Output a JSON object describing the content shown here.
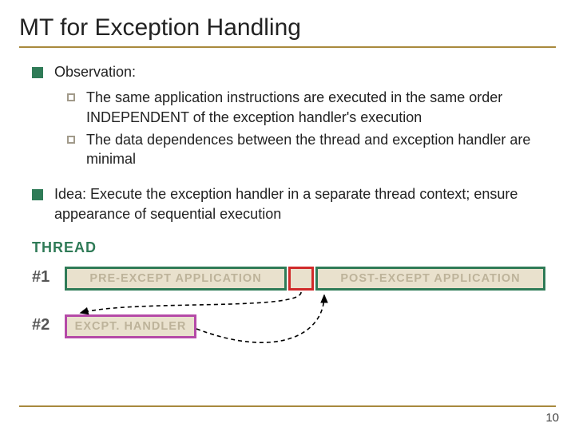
{
  "title": "MT for Exception Handling",
  "observation": {
    "heading": "Observation:",
    "items": [
      "The same application instructions are executed in the same order INDEPENDENT of the exception handler's execution",
      "The data dependences between the thread and exception handler are minimal"
    ]
  },
  "idea": "Idea: Execute the exception handler in a separate thread context; ensure appearance of sequential execution",
  "diagram": {
    "thread_label": "THREAD",
    "row1": "#1",
    "row2": "#2",
    "pre": "PRE-EXCEPT APPLICATION",
    "post": "POST-EXCEPT APPLICATION",
    "handler": "EXCPT. HANDLER"
  },
  "page_number": "10"
}
